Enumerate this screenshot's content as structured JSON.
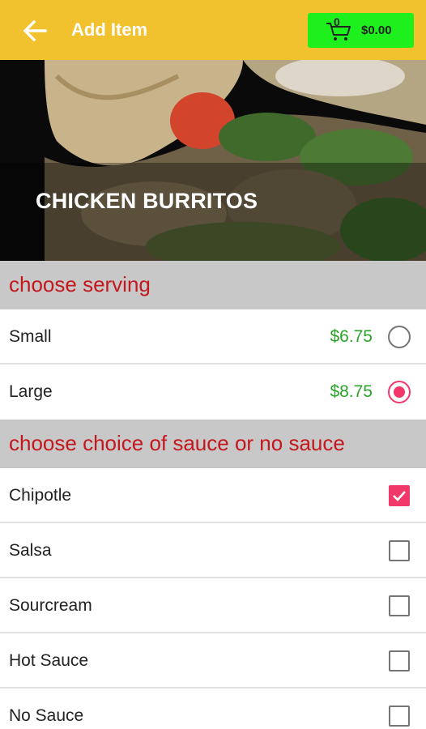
{
  "appbar": {
    "title": "Add Item",
    "back_icon": "arrow-left-icon",
    "cart": {
      "count": "0",
      "total": "$0.00",
      "icon": "cart-icon"
    }
  },
  "hero": {
    "title": "CHICKEN BURRITOS"
  },
  "serving": {
    "header": "choose serving",
    "options": [
      {
        "label": "Small",
        "price": "$6.75",
        "selected": false
      },
      {
        "label": "Large",
        "price": "$8.75",
        "selected": true
      }
    ]
  },
  "sauce": {
    "header": "choose choice of sauce or no sauce",
    "options": [
      {
        "label": "Chipotle",
        "checked": true
      },
      {
        "label": "Salsa",
        "checked": false
      },
      {
        "label": "Sourcream",
        "checked": false
      },
      {
        "label": "Hot Sauce",
        "checked": false
      },
      {
        "label": "No Sauce",
        "checked": false
      }
    ]
  },
  "colors": {
    "appbar": "#f2c12e",
    "cart_button": "#1ef01e",
    "section_header_bg": "#c8c8c8",
    "section_header_text": "#c4171e",
    "price": "#2aa32a",
    "accent": "#f0386b"
  }
}
